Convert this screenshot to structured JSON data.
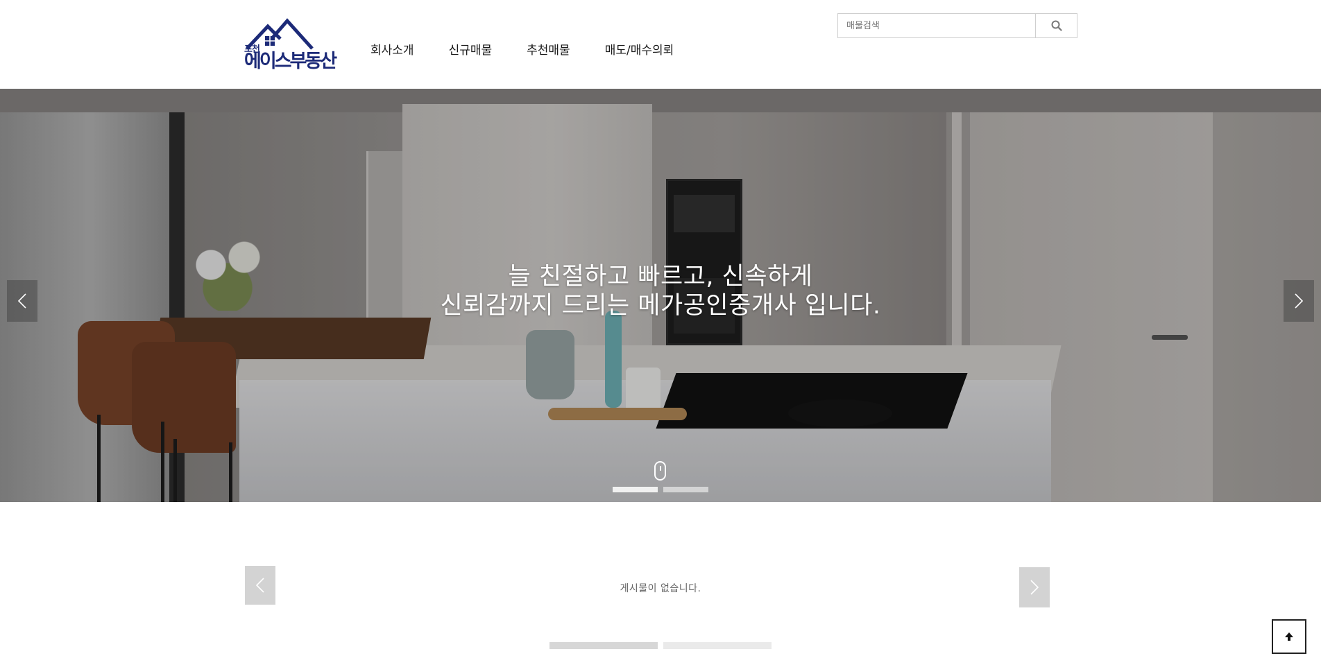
{
  "header": {
    "logo": {
      "small_text": "포천",
      "main_text": "에이스부동산",
      "brand_color": "#1c2a78"
    },
    "nav": [
      {
        "label": "회사소개"
      },
      {
        "label": "신규매물"
      },
      {
        "label": "추천매물"
      },
      {
        "label": "매도/매수의뢰"
      }
    ],
    "search": {
      "placeholder": "매물검색",
      "value": "",
      "button_icon": "search-icon"
    }
  },
  "hero": {
    "line1": "늘 친절하고 빠르고, 신속하게",
    "line2": "신뢰감까지 드리는 메가공인중개사 입니다.",
    "prev_icon": "chevron-left-icon",
    "next_icon": "chevron-right-icon",
    "scroll_icon": "mouse-icon",
    "slides_total": 2,
    "active_slide": 1
  },
  "listing": {
    "empty_message": "게시물이 없습니다.",
    "prev_icon": "chevron-left-icon",
    "next_icon": "chevron-right-icon",
    "pages_total": 2,
    "active_page": 1
  },
  "top_button": {
    "icon": "arrow-up-icon"
  }
}
